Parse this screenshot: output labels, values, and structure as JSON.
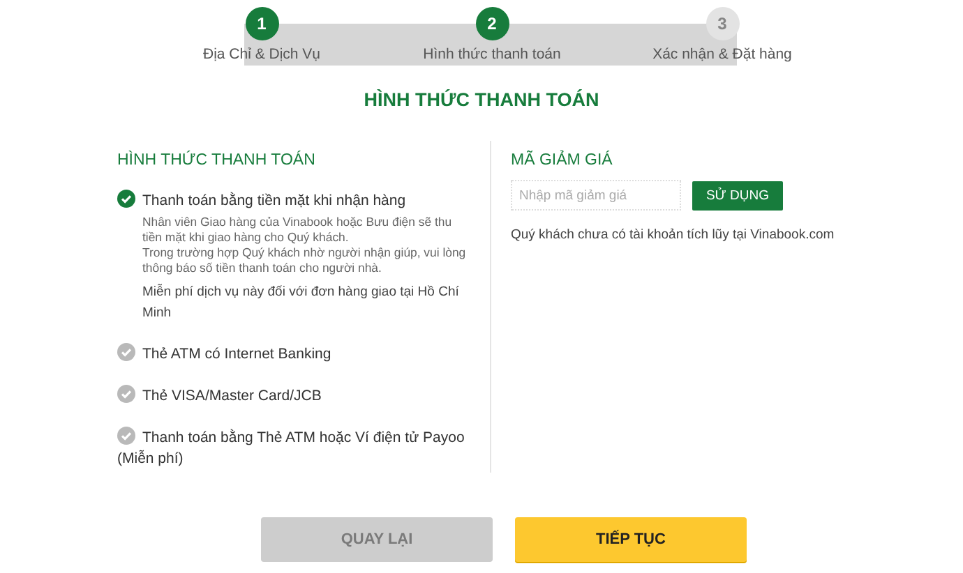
{
  "steps": [
    {
      "number": "1",
      "label": "Địa Chỉ & Dịch Vụ",
      "active": true
    },
    {
      "number": "2",
      "label": "Hình thức thanh toán",
      "active": true
    },
    {
      "number": "3",
      "label": "Xác nhận & Đặt hàng",
      "active": false
    }
  ],
  "page_title": "HÌNH THỨC THANH TOÁN",
  "payment": {
    "heading": "HÌNH THỨC THANH TOÁN",
    "options": [
      {
        "label": "Thanh toán bằng tiền mặt khi nhận hàng",
        "selected": true,
        "details": [
          "Nhân viên Giao hàng của Vinabook hoặc Bưu điện sẽ thu tiền mặt khi giao hàng cho Quý khách.\nTrong trường hợp Quý khách nhờ người nhận giúp, vui lòng thông báo số tiền thanh toán cho người nhà.",
          "Miễn phí dịch vụ này đối với đơn hàng giao tại Hồ Chí Minh"
        ]
      },
      {
        "label": "Thẻ ATM có Internet Banking",
        "selected": false
      },
      {
        "label": "Thẻ VISA/Master Card/JCB",
        "selected": false
      },
      {
        "label": "Thanh toán bằng Thẻ ATM hoặc Ví điện tử Payoo (Miễn phí)",
        "selected": false
      }
    ]
  },
  "coupon": {
    "heading": "MÃ GIẢM GIÁ",
    "placeholder": "Nhập mã giảm giá",
    "button": "SỬ DỤNG",
    "note": "Quý khách chưa có tài khoản tích lũy tại Vinabook.com"
  },
  "actions": [
    {
      "label": "QUAY LẠI",
      "kind": "back",
      "disabled": true
    },
    {
      "label": "TIẾP TỤC",
      "kind": "next",
      "disabled": false
    }
  ]
}
